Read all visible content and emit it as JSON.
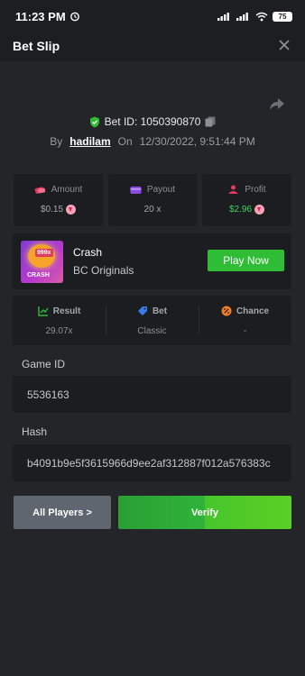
{
  "statusbar": {
    "time": "11:23 PM",
    "battery": "75"
  },
  "header": {
    "title": "Bet Slip"
  },
  "bet": {
    "id_label": "Bet ID: 1050390870",
    "by_label": "By",
    "user": "hadilam",
    "on_label": "On",
    "date": "12/30/2022, 9:51:44 PM"
  },
  "stats": {
    "amount": {
      "label": "Amount",
      "value": "$0.15"
    },
    "payout": {
      "label": "Payout",
      "value": "20 x"
    },
    "profit": {
      "label": "Profit",
      "value": "$2.96"
    }
  },
  "game": {
    "name": "Crash",
    "provider": "BC Originals",
    "thumb_tag": "999x",
    "thumb_text": "CRASH",
    "play_label": "Play Now"
  },
  "results": {
    "result": {
      "label": "Result",
      "value": "29.07x"
    },
    "bet": {
      "label": "Bet",
      "value": "Classic"
    },
    "chance": {
      "label": "Chance",
      "value": "-"
    }
  },
  "fields": {
    "game_id_label": "Game ID",
    "game_id": "5536163",
    "hash_label": "Hash",
    "hash": "b4091b9e5f3615966d9ee2af312887f012a576383c"
  },
  "buttons": {
    "all_players": "All Players >",
    "verify": "Verify"
  },
  "colors": {
    "accent_green": "#2fbd36",
    "profit_green": "#3dd15b",
    "bg": "#232529"
  }
}
